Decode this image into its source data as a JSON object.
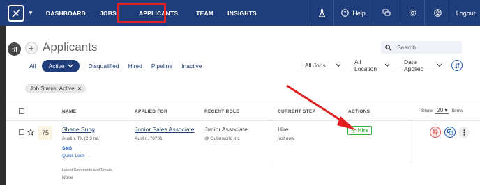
{
  "nav": {
    "items": [
      "DASHBOARD",
      "JOBS",
      "APPLICANTS",
      "TEAM",
      "INSIGHTS"
    ],
    "active": "APPLICANTS",
    "help_label": "Help",
    "logout_label": "Logout"
  },
  "page": {
    "title": "Applicants",
    "search_placeholder": "Search"
  },
  "tabs": {
    "all": "All",
    "active": "Active",
    "disqualified": "Disqualified",
    "hired": "Hired",
    "pipeline": "Pipeline",
    "inactive": "Inactive"
  },
  "filters": {
    "jobs": "All Jobs",
    "location": "All Location",
    "date": "Date Applied"
  },
  "chip": {
    "label": "Job Status: Active",
    "remove": "×"
  },
  "table": {
    "headers": {
      "name": "NAME",
      "applied_for": "APPLIED FOR",
      "recent_role": "RECENT ROLE",
      "current_step": "CURRENT STEP",
      "actions": "ACTIONS"
    },
    "show_label": "Show",
    "show_value": "20",
    "items_label": "Items"
  },
  "row": {
    "score": "75",
    "name": "Shane Sung",
    "location": "Austin, TX (2.3 mi.)",
    "sms": "SMS",
    "quick_look": "Quick Look →",
    "comments_label": "Latest Comments and Emails",
    "comments_value": "None",
    "applied_job": "Junior Sales Associate",
    "job_location": "Austin, 78701",
    "recent_role": "Junior Associate",
    "recent_company": "@ Outerworld Inc",
    "current_step": "Hire",
    "step_time": "just now",
    "action_hire": "Hire"
  },
  "colors": {
    "nav_bg": "#1f3d7a",
    "highlight": "#e02020",
    "hire_green": "#3cb043",
    "score_bg": "#fdf3e1"
  }
}
